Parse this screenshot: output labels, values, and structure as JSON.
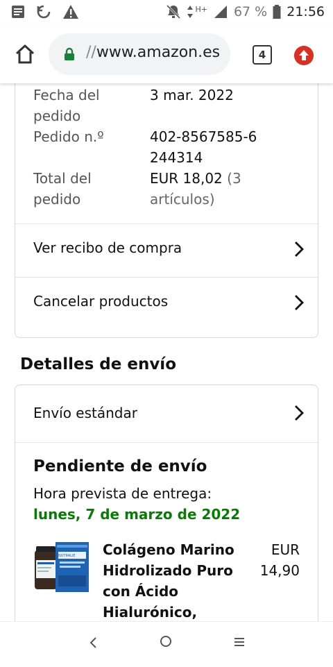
{
  "status_bar": {
    "battery_text": "67 %",
    "time": "21:56",
    "network": "H+"
  },
  "browser": {
    "url_prefix": "//",
    "url_host": "www.amazon.es",
    "tab_count": "4"
  },
  "order": {
    "date_label": "Fecha del pedido",
    "date_value": "3 mar. 2022",
    "number_label": "Pedido n.º",
    "number_value": "402-8567585-6244314",
    "total_label": "Total del pedido",
    "total_value": "EUR 18,02",
    "total_items": "(3 artículos)"
  },
  "actions": {
    "receipt": "Ver recibo de compra",
    "cancel": "Cancelar productos"
  },
  "shipping": {
    "section_title": "Detalles de envío",
    "method": "Envío estándar",
    "status": "Pendiente de envío",
    "eta_label": "Hora prevista de entrega:",
    "eta_date": "lunes, 7 de marzo de 2022"
  },
  "product": {
    "name": "Colágeno Marino Hidrolizado Puro con Ácido Hialurónico,",
    "price_currency": "EUR",
    "price_value": "14,90",
    "brand_text": "NUTRALIE"
  },
  "colors": {
    "accent_green": "#067d00",
    "update_red": "#d93025"
  }
}
